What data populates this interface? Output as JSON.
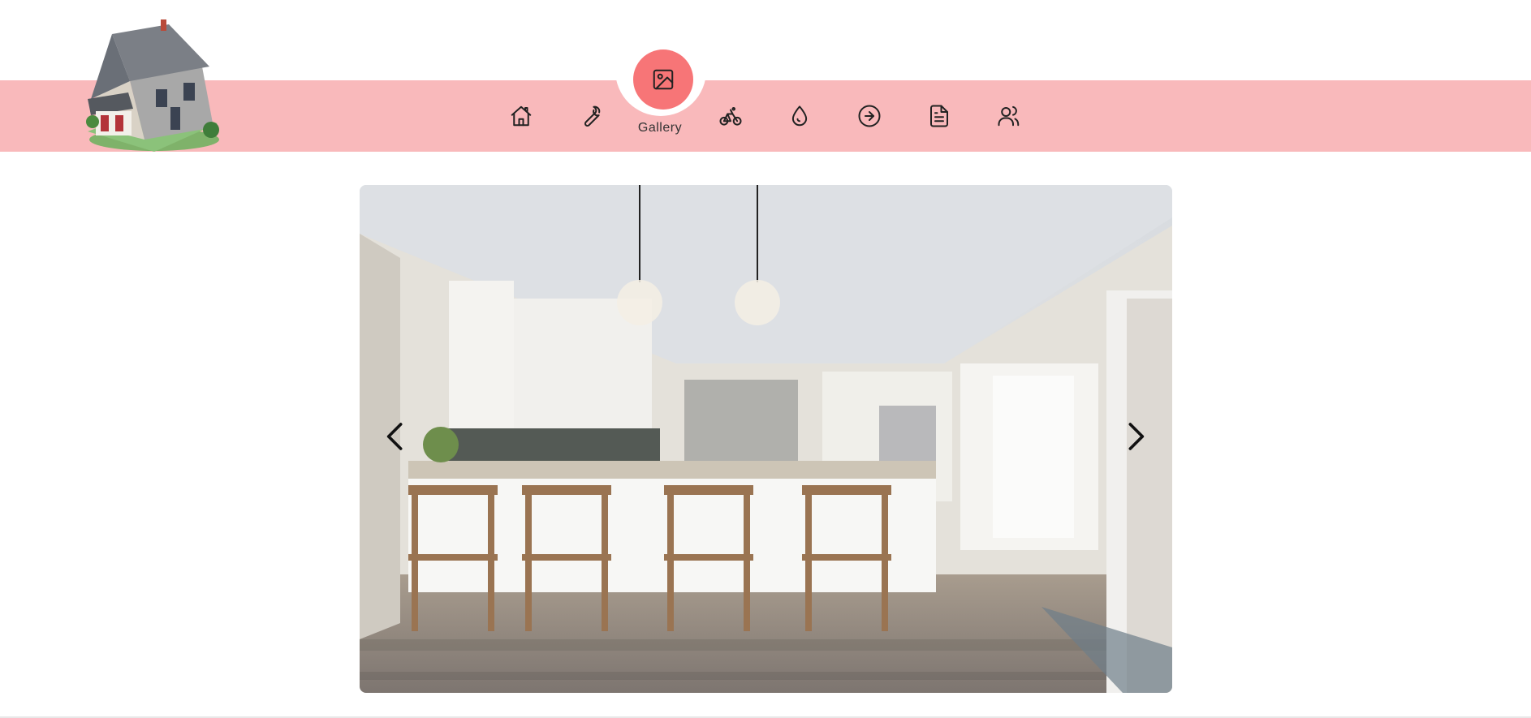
{
  "nav": {
    "items": [
      {
        "icon": "home-icon"
      },
      {
        "icon": "wrench-icon"
      },
      {
        "icon": "image-icon",
        "label": "Gallery",
        "active": true
      },
      {
        "icon": "bicycle-icon"
      },
      {
        "icon": "water-drop-icon"
      },
      {
        "icon": "arrow-circle-right-icon"
      },
      {
        "icon": "document-icon"
      },
      {
        "icon": "users-icon"
      }
    ],
    "active_label": "Gallery"
  },
  "gallery": {
    "prev_icon": "chevron-left-icon",
    "next_icon": "chevron-right-icon"
  },
  "colors": {
    "band": "#f9b9bb",
    "active": "#f77577",
    "icon": "#222222"
  }
}
